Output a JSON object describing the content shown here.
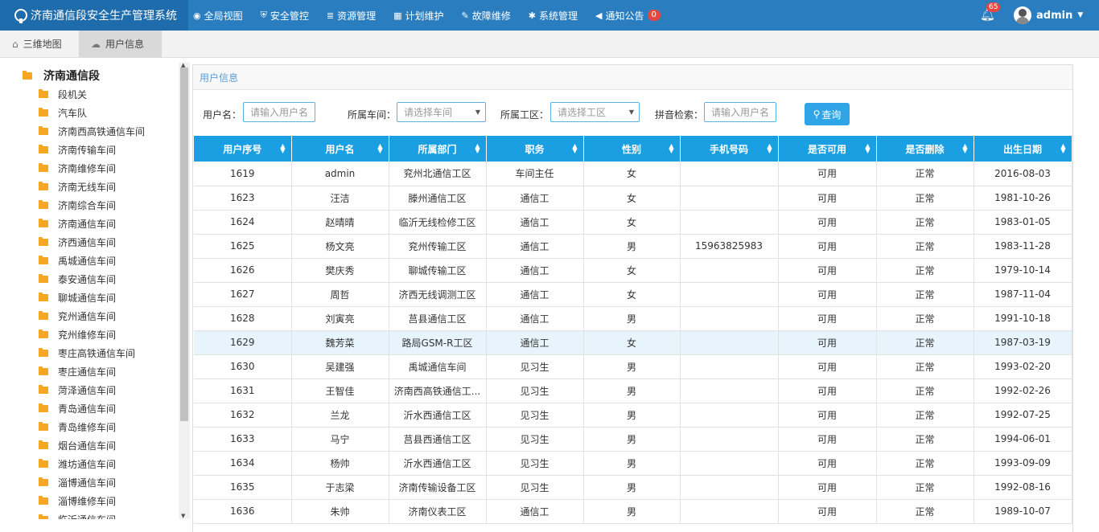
{
  "app": {
    "title": "济南通信段安全生产管理系统"
  },
  "nav": [
    {
      "icon": "globe-icon",
      "glyph": "◉",
      "label": "全局视图"
    },
    {
      "icon": "shield-icon",
      "glyph": "⛨",
      "label": "安全管控"
    },
    {
      "icon": "database-icon",
      "glyph": "≣",
      "label": "资源管理"
    },
    {
      "icon": "calendar-icon",
      "glyph": "▦",
      "label": "计划维护"
    },
    {
      "icon": "wrench-icon",
      "glyph": "✎",
      "label": "故障维修"
    },
    {
      "icon": "gear-icon",
      "glyph": "✱",
      "label": "系统管理"
    },
    {
      "icon": "speaker-icon",
      "glyph": "◀",
      "label": "通知公告",
      "badge": "0"
    }
  ],
  "header": {
    "notifications": "65",
    "username": "admin"
  },
  "tabs": [
    {
      "icon": "home-icon",
      "label": "三维地图"
    },
    {
      "icon": "cloud-icon",
      "label": "用户信息"
    }
  ],
  "tree": {
    "root": "济南通信段",
    "items": [
      "段机关",
      "汽车队",
      "济南西高铁通信车间",
      "济南传输车间",
      "济南维修车间",
      "济南无线车间",
      "济南综合车间",
      "济南通信车间",
      "济西通信车间",
      "禹城通信车间",
      "泰安通信车间",
      "聊城通信车间",
      "兖州通信车间",
      "兖州维修车间",
      "枣庄高铁通信车间",
      "枣庄通信车间",
      "菏泽通信车间",
      "青岛通信车间",
      "青岛维修车间",
      "烟台通信车间",
      "潍坊通信车间",
      "淄博通信车间",
      "淄博维修车间",
      "临沂通信车间"
    ]
  },
  "panel": {
    "title": "用户信息"
  },
  "filters": {
    "username_label": "用户名：",
    "username_placeholder": "请输入用户名",
    "workshop_label": "所属车间：",
    "workshop_placeholder": "请选择车间",
    "area_label": "所属工区：",
    "area_placeholder": "请选择工区",
    "pinyin_label": "拼音检索：",
    "pinyin_placeholder": "请输入用户名",
    "query_label": "查询"
  },
  "table": {
    "columns": [
      "用户序号",
      "用户名",
      "所属部门",
      "职务",
      "性别",
      "手机号码",
      "是否可用",
      "是否删除",
      "出生日期"
    ],
    "rows": [
      [
        "1619",
        "admin",
        "兖州北通信工区",
        "车间主任",
        "女",
        "",
        "可用",
        "正常",
        "2016-08-03"
      ],
      [
        "1623",
        "汪洁",
        "滕州通信工区",
        "通信工",
        "女",
        "",
        "可用",
        "正常",
        "1981-10-26"
      ],
      [
        "1624",
        "赵晴晴",
        "临沂无线检修工区",
        "通信工",
        "女",
        "",
        "可用",
        "正常",
        "1983-01-05"
      ],
      [
        "1625",
        "杨文亮",
        "兖州传输工区",
        "通信工",
        "男",
        "15963825983",
        "可用",
        "正常",
        "1983-11-28"
      ],
      [
        "1626",
        "樊庆秀",
        "聊城传输工区",
        "通信工",
        "女",
        "",
        "可用",
        "正常",
        "1979-10-14"
      ],
      [
        "1627",
        "周哲",
        "济西无线调测工区",
        "通信工",
        "女",
        "",
        "可用",
        "正常",
        "1987-11-04"
      ],
      [
        "1628",
        "刘寅亮",
        "莒县通信工区",
        "通信工",
        "男",
        "",
        "可用",
        "正常",
        "1991-10-18"
      ],
      [
        "1629",
        "魏芳菜",
        "路局GSM-R工区",
        "通信工",
        "女",
        "",
        "可用",
        "正常",
        "1987-03-19"
      ],
      [
        "1630",
        "吴建强",
        "禹城通信车间",
        "见习生",
        "男",
        "",
        "可用",
        "正常",
        "1993-02-20"
      ],
      [
        "1631",
        "王智佳",
        "济南西高铁通信工...",
        "见习生",
        "男",
        "",
        "可用",
        "正常",
        "1992-02-26"
      ],
      [
        "1632",
        "兰龙",
        "沂水西通信工区",
        "见习生",
        "男",
        "",
        "可用",
        "正常",
        "1992-07-25"
      ],
      [
        "1633",
        "马宁",
        "莒县西通信工区",
        "见习生",
        "男",
        "",
        "可用",
        "正常",
        "1994-06-01"
      ],
      [
        "1634",
        "杨帅",
        "沂水西通信工区",
        "见习生",
        "男",
        "",
        "可用",
        "正常",
        "1993-09-09"
      ],
      [
        "1635",
        "于志梁",
        "济南传输设备工区",
        "见习生",
        "男",
        "",
        "可用",
        "正常",
        "1992-08-16"
      ],
      [
        "1636",
        "朱帅",
        "济南仪表工区",
        "通信工",
        "男",
        "",
        "可用",
        "正常",
        "1989-10-07"
      ]
    ],
    "highlighted_row": 7
  },
  "colors": {
    "topbar": "#2a7ec0",
    "brand": "#1e6cab",
    "header_row": "#1aa0e2",
    "query_button": "#2fa4e7",
    "folder": "#f5a623",
    "badge": "#e8473f"
  }
}
